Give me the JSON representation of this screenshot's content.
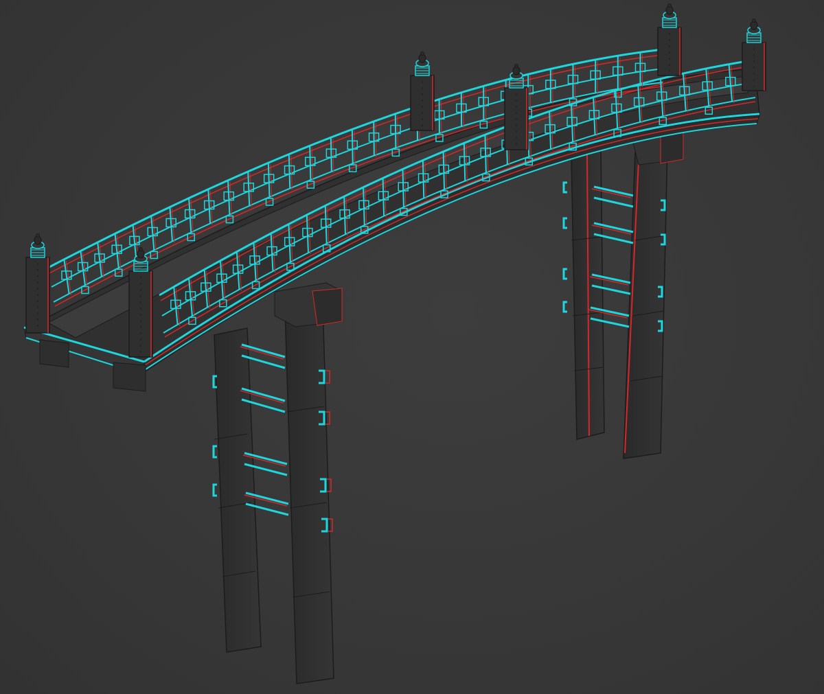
{
  "viewport": {
    "background": "#383838",
    "solid_fill": "#303030",
    "solid_fill_light": "#3c3c3c",
    "edge_color": "#1c1c1c",
    "selection_color": "#1fd6dc",
    "backface_color": "#d62828"
  },
  "model": {
    "icon": "wooden-arched-bridge-wireframe",
    "posts": 6,
    "support_legs": 4
  }
}
